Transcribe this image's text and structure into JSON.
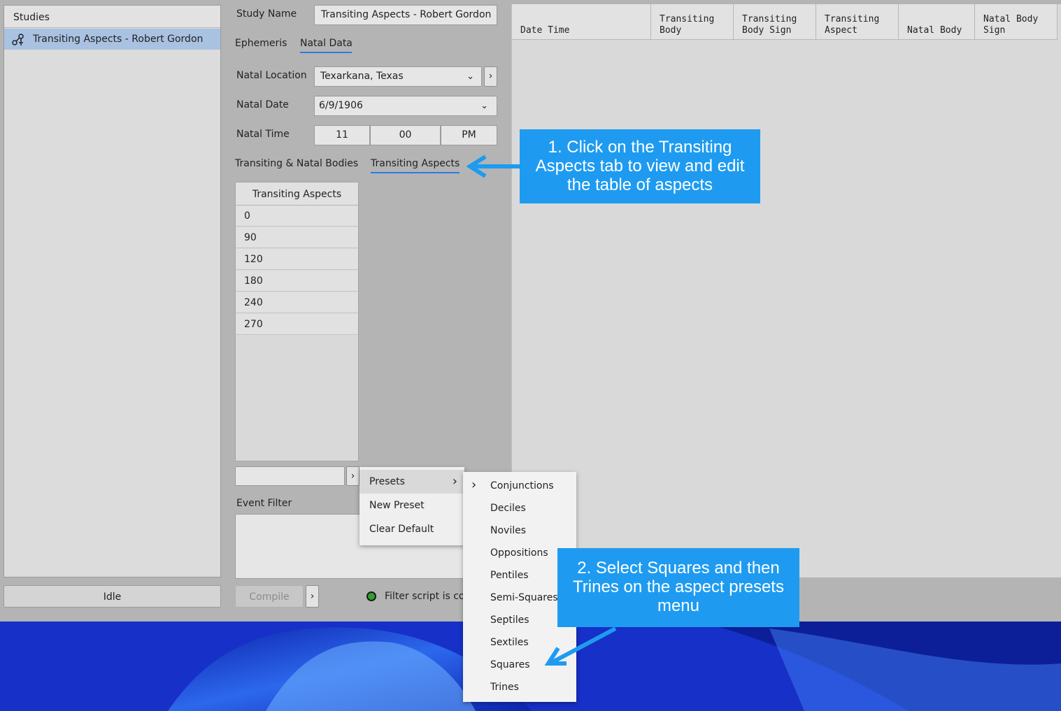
{
  "sidebar": {
    "header": "Studies",
    "study_item": "Transiting Aspects - Robert Gordon",
    "status": "Idle"
  },
  "study": {
    "name_label": "Study Name",
    "name_value": "Transiting Aspects - Robert Gordon",
    "tabs": [
      "Ephemeris",
      "Natal Data"
    ],
    "natal_location_label": "Natal Location",
    "natal_location_value": "Texarkana, Texas",
    "natal_date_label": "Natal Date",
    "natal_date_value": "6/9/1906",
    "natal_time_label": "Natal Time",
    "natal_time_hour": "11",
    "natal_time_minute": "00",
    "natal_time_ampm": "PM",
    "lower_tabs": [
      "Transiting & Natal Bodies",
      "Transiting Aspects"
    ],
    "aspects_header": "Transiting Aspects",
    "aspects": [
      "0",
      "90",
      "120",
      "180",
      "240",
      "270"
    ],
    "event_filter_label": "Event Filter",
    "compile_label": "Compile",
    "filter_status": "Filter script is cor"
  },
  "grid": {
    "columns": [
      "Date Time",
      "Transiting\nBody",
      "Transiting\nBody Sign",
      "Transiting\nAspect",
      "Natal Body",
      "Natal Body\nSign"
    ]
  },
  "context_menu": {
    "items": [
      "Presets",
      "New Preset",
      "Clear Default"
    ]
  },
  "presets_submenu": {
    "items": [
      "Conjunctions",
      "Deciles",
      "Noviles",
      "Oppositions",
      "Pentiles",
      "Semi-Squares",
      "Septiles",
      "Sextiles",
      "Squares",
      "Trines"
    ]
  },
  "callouts": {
    "step1": "1. Click on the Transiting Aspects tab to view and edit the table of aspects",
    "step2": "2. Select Squares and then Trines on the aspect presets menu"
  },
  "colors": {
    "callout": "#1e9bf0",
    "accent": "#2a7be4",
    "selection": "#a9c2e1",
    "status_led": "#2fa12f"
  }
}
